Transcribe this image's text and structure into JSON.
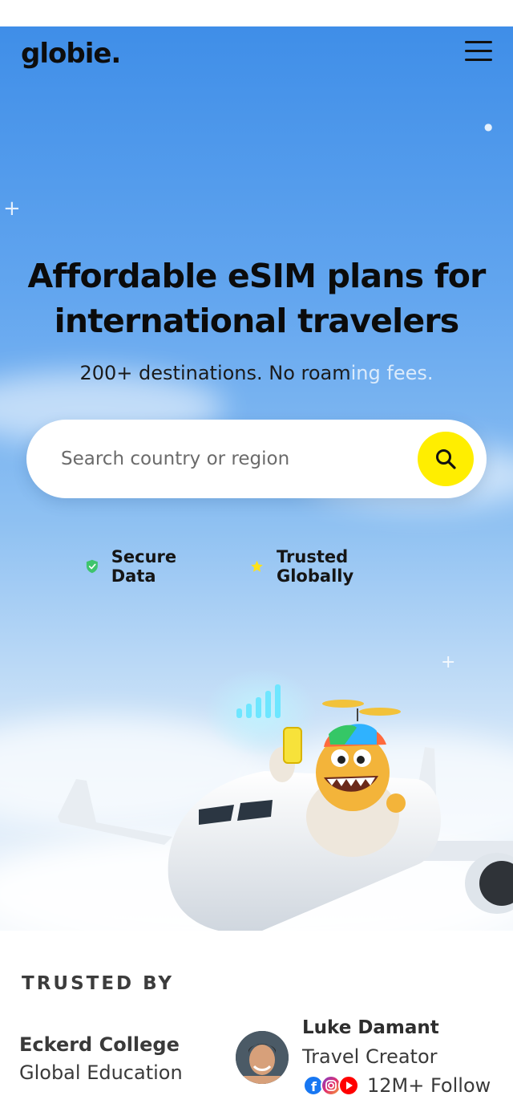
{
  "header": {
    "logo": "globie.",
    "menu_icon": "hamburger-menu-icon"
  },
  "hero": {
    "headline_line1": "Affordable eSIM plans for",
    "headline_line2": "international travelers",
    "subhead_main": "200+ destinations. No roam",
    "subhead_faded": "ing fees."
  },
  "search": {
    "placeholder": "Search country or region",
    "button_icon": "search-icon",
    "button_color": "#ffee00"
  },
  "badges": [
    {
      "icon": "shield-check-icon",
      "label": "Secure Data",
      "color": "#3ec46d"
    },
    {
      "icon": "star-icon",
      "label": "Trusted Globally",
      "color": "#ffe21a"
    }
  ],
  "trusted": {
    "title": "TRUSTED BY",
    "college_line1": "Eckerd College",
    "college_line2": "Global Education",
    "creator": {
      "name": "Luke Damant",
      "role": "Travel Creator",
      "followers": "12M+ Follow",
      "social_icons": [
        "facebook-icon",
        "instagram-icon",
        "youtube-icon"
      ]
    }
  }
}
